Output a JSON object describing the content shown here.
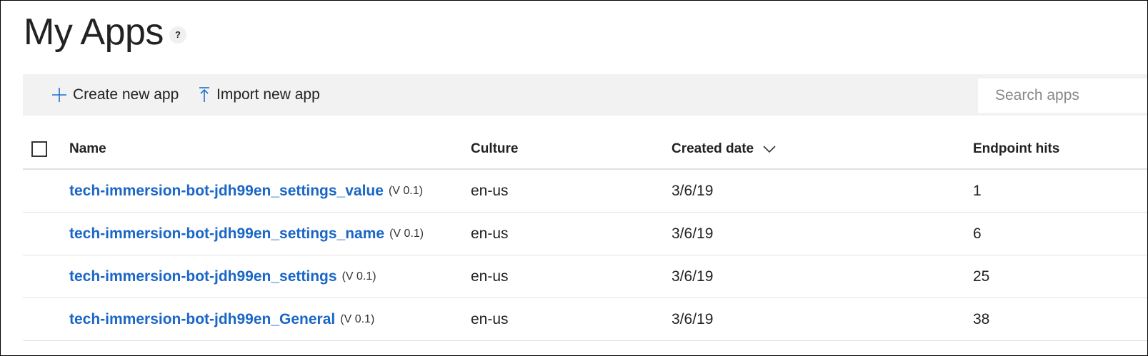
{
  "page": {
    "title": "My Apps",
    "help_label": "?"
  },
  "toolbar": {
    "create_label": "Create new app",
    "create_icon": "plus-icon",
    "import_label": "Import new app",
    "import_icon": "upload-icon",
    "search_placeholder": "Search apps",
    "search_value": ""
  },
  "table": {
    "columns": {
      "name": "Name",
      "culture": "Culture",
      "created_date": "Created date",
      "endpoint_hits": "Endpoint hits"
    },
    "sort_icon": "chevron-down-icon",
    "rows": [
      {
        "name": "tech-immersion-bot-jdh99en_settings_value",
        "version": "(V 0.1)",
        "culture": "en-us",
        "created": "3/6/19",
        "hits": "1"
      },
      {
        "name": "tech-immersion-bot-jdh99en_settings_name",
        "version": "(V 0.1)",
        "culture": "en-us",
        "created": "3/6/19",
        "hits": "6"
      },
      {
        "name": "tech-immersion-bot-jdh99en_settings",
        "version": "(V 0.1)",
        "culture": "en-us",
        "created": "3/6/19",
        "hits": "25"
      },
      {
        "name": "tech-immersion-bot-jdh99en_General",
        "version": "(V 0.1)",
        "culture": "en-us",
        "created": "3/6/19",
        "hits": "38"
      }
    ]
  },
  "colors": {
    "accent": "#1e6fcf",
    "link": "#1a66c7",
    "toolbar_bg": "#f2f2f2",
    "divider": "#e1e1e1"
  }
}
